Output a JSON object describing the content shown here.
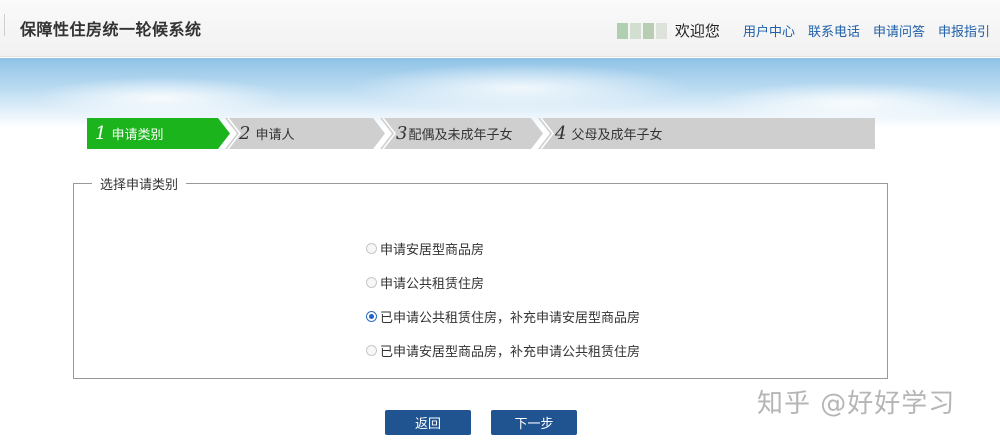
{
  "header": {
    "title": "保障性住房统一轮候系统",
    "welcome": "欢迎您",
    "links": [
      "用户中心",
      "联系电话",
      "申请问答",
      "申报指引"
    ]
  },
  "steps": [
    {
      "num": "1",
      "label": "申请类别",
      "active": true
    },
    {
      "num": "2",
      "label": "申请人",
      "active": false
    },
    {
      "num": "3",
      "label": "配偶及未成年子女",
      "active": false
    },
    {
      "num": "4",
      "label": "父母及成年子女",
      "active": false
    }
  ],
  "form": {
    "legend": "选择申请类别",
    "options": [
      {
        "label": "申请安居型商品房",
        "checked": false
      },
      {
        "label": "申请公共租赁住房",
        "checked": false
      },
      {
        "label": "已申请公共租赁住房，补充申请安居型商品房",
        "checked": true
      },
      {
        "label": "已申请安居型商品房，补充申请公共租赁住房",
        "checked": false
      }
    ]
  },
  "buttons": {
    "back": "返回",
    "next": "下一步"
  },
  "watermark": "知乎 @好好学习",
  "colors": {
    "step_active": "#1cb41c",
    "step_inactive": "#cfcfcf",
    "button": "#1f5490",
    "link": "#1f5fa8"
  }
}
